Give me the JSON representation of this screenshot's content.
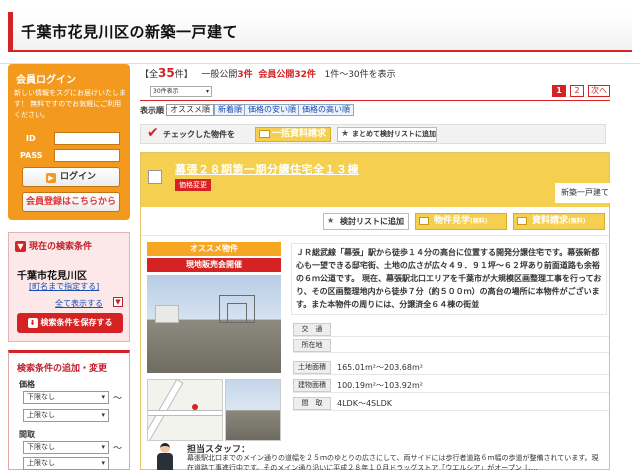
{
  "header": {
    "title": "千葉市花見川区の新築一戸建て"
  },
  "login": {
    "title": "会員ログイン",
    "description": "新しい情報をスグにお届けいたします！ 無料ですのでお気軽にご利用ください。",
    "id_label": "ID",
    "pass_label": "PASS",
    "login_button": "ログイン",
    "register_button": "会員登録はこちらから"
  },
  "current_conditions": {
    "title": "現在の検索条件",
    "area": "千葉市花見川区",
    "change_link": "[町名まで指定する]",
    "show_all": "全て表示する",
    "toggle_icon": "▼",
    "save_button": "検索条件を保存する"
  },
  "add_conditions": {
    "title": "検索条件の追加・変更",
    "price_label": "価格",
    "price_min": "下限なし",
    "price_max": "上限なし",
    "tilde": "〜",
    "layout_label": "間取",
    "layout_min": "下限なし",
    "layout_max": "上限なし"
  },
  "results": {
    "total_prefix": "【全",
    "total": "35",
    "total_suffix": "件】",
    "general_label": "一般公開",
    "general": "3件",
    "member_label": "会員公開",
    "member": "32件",
    "range": "1件〜30件を表示",
    "per_page": "30件表示",
    "pages": [
      "1",
      "2"
    ],
    "next": "次へ"
  },
  "sort": {
    "label": "表示順",
    "options": [
      "オススメ順",
      "新着順",
      "価格の安い順",
      "価格の高い順"
    ]
  },
  "bulk": {
    "checked_label": "チェックした物件を",
    "request_docs": "一括資料請求",
    "free": "(無料)",
    "add_compare": "まとめて検討リストに追加"
  },
  "listing": {
    "title": "幕張２８期第一期分譲住宅全１３棟",
    "badge": "価格変更",
    "type": "新築一戸建て",
    "compare_button": "検討リストに追加",
    "visit_button": "物件見学",
    "docs_button": "資料請求",
    "free": "(無料)",
    "recommend": "オススメ物件",
    "sale_label": "現地販売会開催",
    "description": "ＪＲ総武線「幕張」駅から徒歩１４分の高台に位置する開発分譲住宅です。幕張新都心も一望できる邸宅街、土地の広さが広々４９．９１坪〜６２坪あり前面道路も余裕の６ｍ公道です。 現在、幕張駅北口エリアを千葉市が大規模区画整理工事を行っており、その区画整理地内から徒歩７分（約５００ｍ）の高台の場所に本物件がございます。また本物件の周りには、分譲済全６４棟の街並",
    "specs": [
      {
        "label": "交　通",
        "value": ""
      },
      {
        "label": "所在地",
        "value": ""
      },
      {
        "label": "土地面積",
        "value": "165.01m²〜203.68m²"
      },
      {
        "label": "建物面積",
        "value": "100.19m²〜103.92m²"
      },
      {
        "label": "間　取",
        "value": "4LDK〜4SLDK"
      }
    ],
    "staff_title": "担当スタッフ：",
    "staff_comment": "幕張駅北口までのメイン通りの道幅を２５ｍのゆとりの広さにして、両サイドには歩行者道路６ｍ幅の歩道が整備されています。現在道路工事進行中です。そのメイン通り沿いに平成２８年１０月ドラッグストア「ウエルシア」がオープン し..."
  },
  "colors": {
    "accent": "#d52323",
    "login_orange": "#f39a1e",
    "listing_yellow": "#f5cf50"
  }
}
